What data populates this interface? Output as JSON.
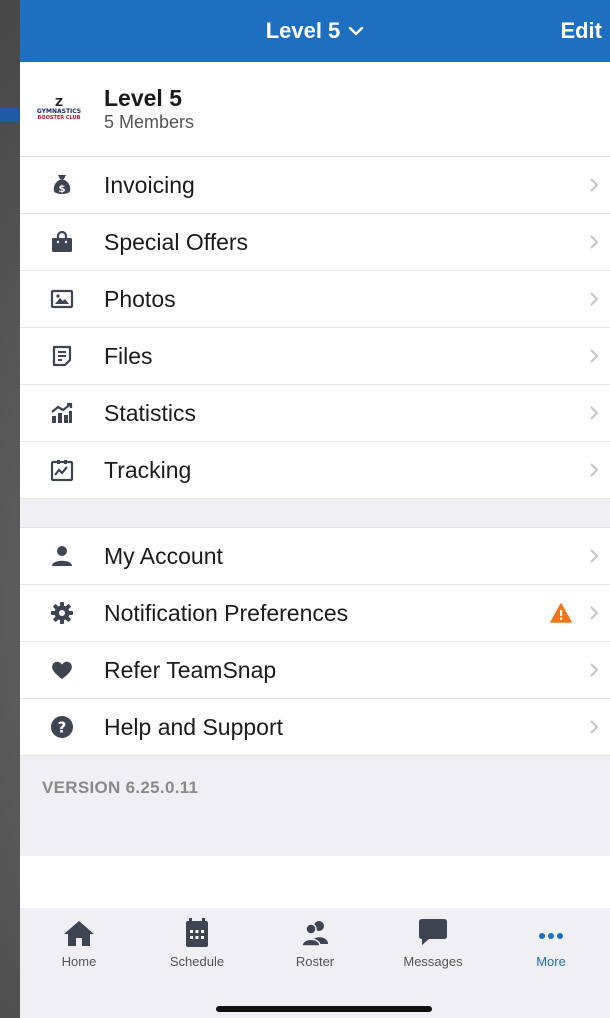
{
  "nav": {
    "title": "Level 5",
    "edit_label": "Edit"
  },
  "team": {
    "logo_text": "Z",
    "logo_line1": "GYMNASTICS",
    "logo_line2": "BOOSTER CLUB",
    "name": "Level 5",
    "members": "5 Members"
  },
  "menu_primary": [
    {
      "label": "Invoicing",
      "icon": "money-bag-icon"
    },
    {
      "label": "Special Offers",
      "icon": "shopping-bag-icon"
    },
    {
      "label": "Photos",
      "icon": "photo-icon"
    },
    {
      "label": "Files",
      "icon": "file-icon"
    },
    {
      "label": "Statistics",
      "icon": "statistics-icon"
    },
    {
      "label": "Tracking",
      "icon": "tracking-icon"
    }
  ],
  "menu_secondary": [
    {
      "label": "My Account",
      "icon": "user-icon"
    },
    {
      "label": "Notification Preferences",
      "icon": "gear-icon",
      "warning": true
    },
    {
      "label": "Refer TeamSnap",
      "icon": "heart-icon"
    },
    {
      "label": "Help and Support",
      "icon": "help-icon"
    }
  ],
  "version": "VERSION 6.25.0.11",
  "tabs": [
    {
      "label": "Home",
      "icon": "home-icon"
    },
    {
      "label": "Schedule",
      "icon": "calendar-icon"
    },
    {
      "label": "Roster",
      "icon": "roster-icon"
    },
    {
      "label": "Messages",
      "icon": "message-icon"
    },
    {
      "label": "More",
      "icon": "more-icon",
      "active": true
    }
  ],
  "colors": {
    "brand_blue": "#1f6fc0",
    "warning_orange": "#f0761b",
    "icon_dark": "#3e4452",
    "chevron": "#c4c4c9"
  }
}
